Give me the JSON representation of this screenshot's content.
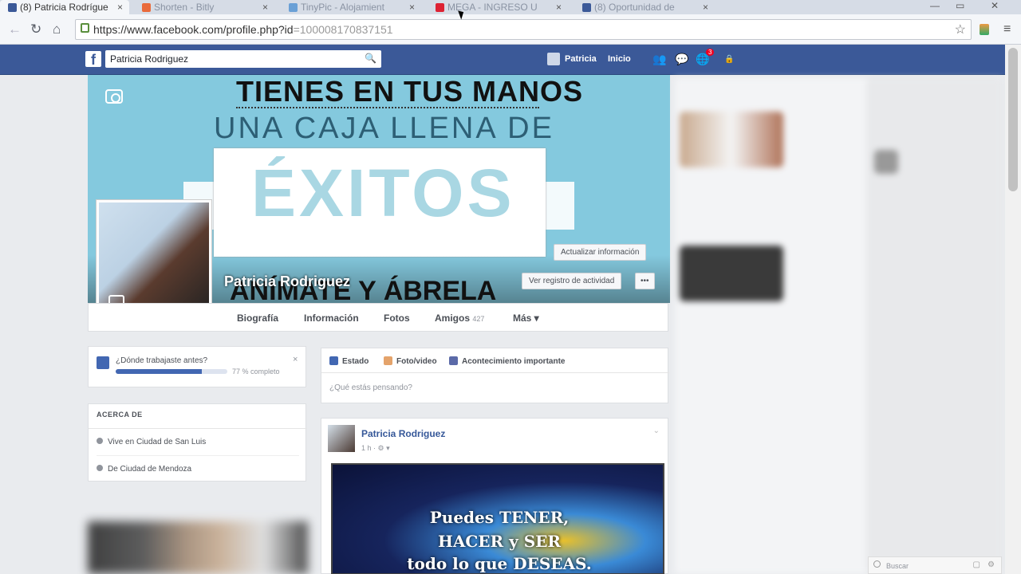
{
  "browser": {
    "tabs": [
      {
        "label": "(8) Patricia Rodrígue",
        "active": true
      },
      {
        "label": "Shorten - Bitly",
        "active": false
      },
      {
        "label": "TinyPic - Alojamient",
        "active": false
      },
      {
        "label": "MEGA - INGRESO U",
        "active": false
      },
      {
        "label": "(8) Oportunidad de",
        "active": false
      }
    ],
    "tab_close": "×",
    "url_host": "https://www.facebook.com/profile.php?id",
    "url_rest": "=100008170837151",
    "star": "☆",
    "menu": "≡",
    "win_min": "—",
    "win_max": "▭",
    "win_close": "✕"
  },
  "fb_header": {
    "logo": "f",
    "search_value": "Patricia Rodriguez",
    "search_icon": "🔍",
    "user_name": "Patricia",
    "home": "Inicio",
    "notif_badge": "3"
  },
  "cover": {
    "line1": "TIENES EN TUS MANOS",
    "line2": "UNA CAJA LLENA DE",
    "line3": "ÉXITOS",
    "line4": "ANÍMATE Y ÁBRELA"
  },
  "profile": {
    "name": "Patricia Rodriguez",
    "update_info": "Actualizar información",
    "activity_log": "Ver registro de actividad",
    "more_dots": "•••"
  },
  "profile_tabs": [
    {
      "label": "Biografía"
    },
    {
      "label": "Información"
    },
    {
      "label": "Fotos"
    },
    {
      "label": "Amigos"
    },
    {
      "label": "Más ▾"
    }
  ],
  "friends_count": "427",
  "progress": {
    "question": "¿Dónde trabajaste antes?",
    "percent": 77,
    "percent_label": "77 % completo",
    "close": "×"
  },
  "about": {
    "heading": "ACERCA DE",
    "lives": "Vive en Ciudad de San Luis",
    "from": "De Ciudad de Mendoza"
  },
  "composer": {
    "status": "Estado",
    "photo": "Foto/video",
    "event": "Acontecimiento importante",
    "placeholder": "¿Qué estás pensando?"
  },
  "post": {
    "author": "Patricia Rodriguez",
    "meta": "1 h · ⚙ ▾",
    "line1": "Puedes TENER,",
    "line2": "HACER y SER",
    "line3": "todo lo que DESEAS."
  },
  "chat": {
    "search": "Buscar"
  },
  "colors": {
    "fb_blue": "#3b5998",
    "link_blue": "#365899",
    "cover_blue": "#84c9de"
  }
}
